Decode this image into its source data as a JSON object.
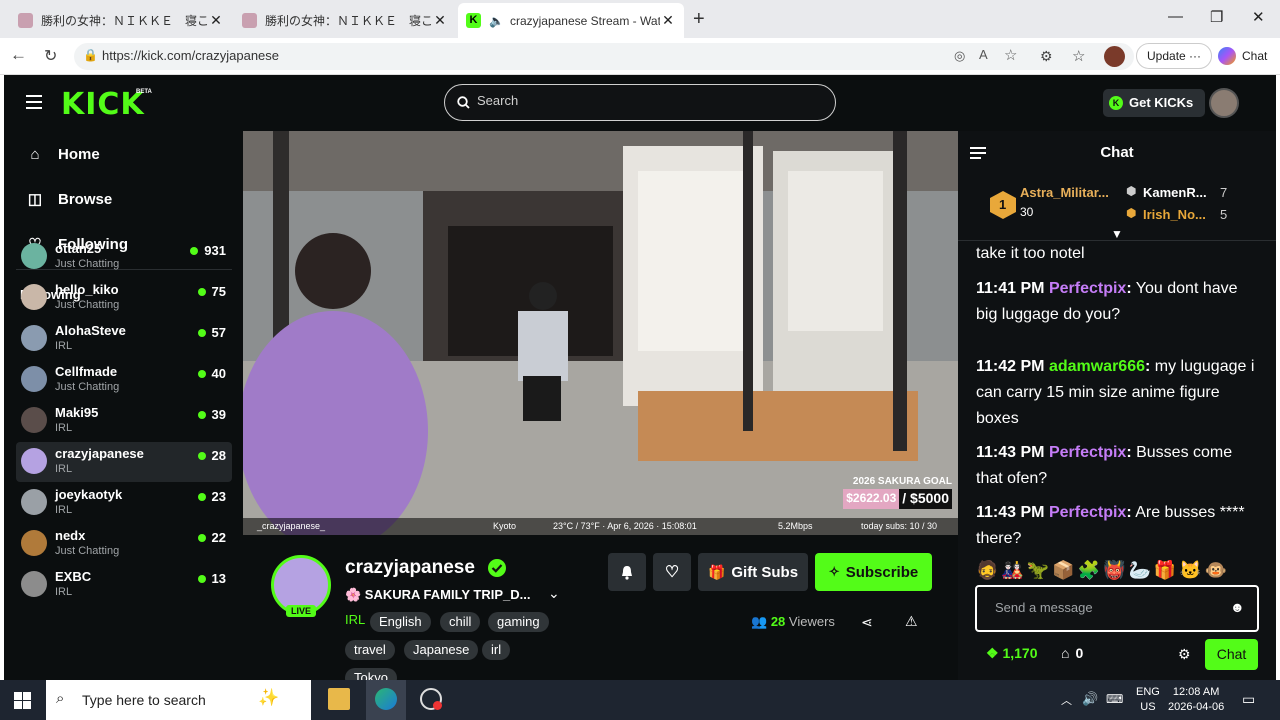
{
  "browser": {
    "tabs": [
      {
        "title": "勝利の女神：ＮＩＫＫＥ　寝ころび",
        "active": false
      },
      {
        "title": "勝利の女神：ＮＩＫＫＥ　寝ころび",
        "active": false
      },
      {
        "title": "crazyjapanese Stream - Watch",
        "active": true
      }
    ],
    "url": "https://kick.com/crazyjapanese",
    "update_label": "Update",
    "copilot_label": "Chat"
  },
  "kick": {
    "logo": "KICK",
    "beta": "BETA",
    "search_placeholder": "Search",
    "get_kicks": "Get KICKs",
    "brand_color": "#53fc18"
  },
  "sidebar": {
    "nav": [
      {
        "label": "Home",
        "icon": "home-icon"
      },
      {
        "label": "Browse",
        "icon": "browse-icon"
      },
      {
        "label": "Following",
        "icon": "heart-icon"
      }
    ],
    "following_header": "Following",
    "following": [
      {
        "name": "ottan25",
        "category": "Just Chatting",
        "viewers": "931",
        "color": "#6bb3a0"
      },
      {
        "name": "hello_kiko",
        "category": "Just Chatting",
        "viewers": "75",
        "color": "#c9b7a8"
      },
      {
        "name": "AlohaSteve",
        "category": "IRL",
        "viewers": "57",
        "color": "#8a9bb0"
      },
      {
        "name": "Cellfmade",
        "category": "Just Chatting",
        "viewers": "40",
        "color": "#7d8fa8"
      },
      {
        "name": "Maki95",
        "category": "IRL",
        "viewers": "39",
        "color": "#5a4d4a"
      },
      {
        "name": "crazyjapanese",
        "category": "IRL",
        "viewers": "28",
        "color": "#b5a2e2"
      },
      {
        "name": "joeykaotyk",
        "category": "IRL",
        "viewers": "23",
        "color": "#9aa0a6"
      },
      {
        "name": "nedx",
        "category": "Just Chatting",
        "viewers": "22",
        "color": "#b07a3a"
      },
      {
        "name": "EXBC",
        "category": "IRL",
        "viewers": "13",
        "color": "#8c8c8c"
      }
    ]
  },
  "video": {
    "goal_title": "2026 SAKURA GOAL",
    "goal_raised": "$2622.03",
    "goal_target": "/ $5000",
    "goal_fraction": 0.52,
    "overlay_channel": "_crazyjapanese_",
    "overlay_location": "Kyoto",
    "overlay_weather": "23°C / 73°F · Apr 6, 2026 · 15:08:01",
    "overlay_bitrate": "5.2Mbps",
    "overlay_subs": "today subs: 10 / 30"
  },
  "stream": {
    "name": "crazyjapanese",
    "live": "LIVE",
    "title": "🌸 SAKURA FAMILY TRIP_D...",
    "category": "IRL",
    "tags": [
      "English",
      "chill",
      "gaming",
      "travel",
      "Japanese",
      "irl",
      "Tokyo"
    ],
    "gift_subs": "Gift Subs",
    "subscribe": "Subscribe",
    "viewer_count": "28",
    "viewers_label": "Viewers"
  },
  "chat": {
    "title": "Chat",
    "leaderboard": [
      {
        "rank": "1",
        "name": "Astra_Militar...",
        "count": "30"
      },
      {
        "name": "KamenR...",
        "count": "7"
      },
      {
        "name": "Irish_No...",
        "count": "5"
      }
    ],
    "partial_message": "take it too notel",
    "messages": [
      {
        "time": "11:41 PM",
        "user": "Perfectpix",
        "color": "#c57df7",
        "text": "You dont have big luggage do you?"
      },
      {
        "time": "11:42 PM",
        "user": "adamwar666",
        "color": "#53fc18",
        "text": "my lugugage i can carry 15 min size anime figure boxes"
      },
      {
        "time": "11:43 PM",
        "user": "Perfectpix",
        "color": "#c57df7",
        "text": "Busses come that ofen?"
      },
      {
        "time": "11:43 PM",
        "user": "Perfectpix",
        "color": "#c57df7",
        "text": "Are busses **** there?"
      }
    ],
    "input_placeholder": "Send a message",
    "points": "1,170",
    "points2": "0",
    "send_label": "Chat"
  },
  "taskbar": {
    "search_placeholder": "Type here to search",
    "lang_top": "ENG",
    "lang_bottom": "US",
    "time": "12:08 AM",
    "date": "2026-04-06"
  }
}
